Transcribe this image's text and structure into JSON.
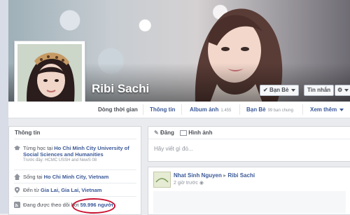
{
  "profile": {
    "name": "Ribi Sachi",
    "friend_button": "Bạn Bè",
    "message_button": "Tin nhắn"
  },
  "tabs": [
    {
      "label": "Dòng thời gian",
      "count": ""
    },
    {
      "label": "Thông tin",
      "count": ""
    },
    {
      "label": "Album ảnh",
      "count": "1.455"
    },
    {
      "label": "Bạn Bè",
      "count": "99 bạn chung"
    },
    {
      "label": "Xem thêm",
      "count": ""
    }
  ],
  "info": {
    "title": "Thông tin",
    "study_prefix": "Từng học tại",
    "study_school": "Ho Chi Minh City University of Social Sciences and Humanities",
    "study_sub": "Trước đây: HCMC USSH and NewS 08",
    "lives_prefix": "Sống tại",
    "lives_place": "Ho Chi Minh City, Vietnam",
    "from_prefix": "Đến từ",
    "from_place": "Gia Lai, Gia Lai, Vietnam",
    "followers_prefix": "Đang được theo dõi bởi",
    "followers_count": "59.996 người"
  },
  "composer": {
    "tab_status": "Đăng",
    "tab_photo": "Hình ảnh",
    "placeholder": "Hãy viết gì đó..."
  },
  "post": {
    "author": "Nhat Sinh Nguyen",
    "target": "Ribi Sachi",
    "time": "2 giờ trước"
  },
  "colors": {
    "accent": "#3b5998",
    "highlight_circle": "#c8102e"
  }
}
